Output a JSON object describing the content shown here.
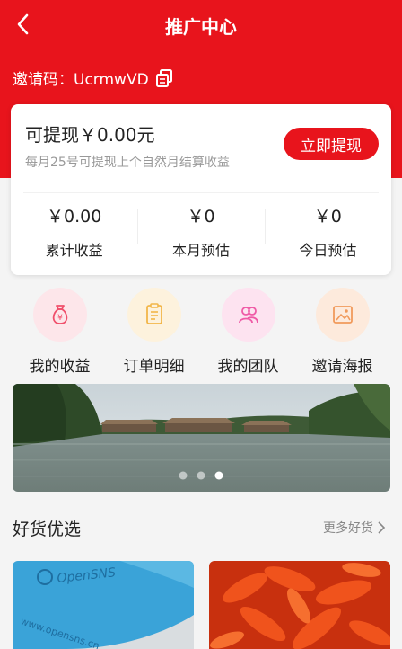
{
  "nav": {
    "title": "推广中心"
  },
  "invite": {
    "text": "邀请码：UcrmwVD"
  },
  "card": {
    "withdraw_text": "可提现￥0.00元",
    "withdraw_note": "每月25号可提现上个自然月结算收益",
    "withdraw_button": "立即提现",
    "stats": [
      {
        "value": "￥0.00",
        "label": "累计收益"
      },
      {
        "value": "￥0",
        "label": "本月预估"
      },
      {
        "value": "￥0",
        "label": "今日预估"
      }
    ]
  },
  "menu": [
    {
      "label": "我的收益",
      "icon": "money-bag-icon",
      "color": "#f04f6b"
    },
    {
      "label": "订单明细",
      "icon": "order-list-icon",
      "color": "#f2b64a"
    },
    {
      "label": "我的团队",
      "icon": "team-icon",
      "color": "#ef5aa6"
    },
    {
      "label": "邀请海报",
      "icon": "poster-icon",
      "color": "#f19a5b"
    }
  ],
  "banner": {
    "dots": 3,
    "active_index": 2
  },
  "section": {
    "title": "好货优选",
    "more": "更多好货"
  },
  "products": [
    {
      "image_text": "OpenSNS",
      "image_subtext": "www.opensns.cn"
    },
    {
      "image_text": ""
    }
  ],
  "colors": {
    "primary": "#e8141c",
    "background": "#f4f4f4"
  }
}
